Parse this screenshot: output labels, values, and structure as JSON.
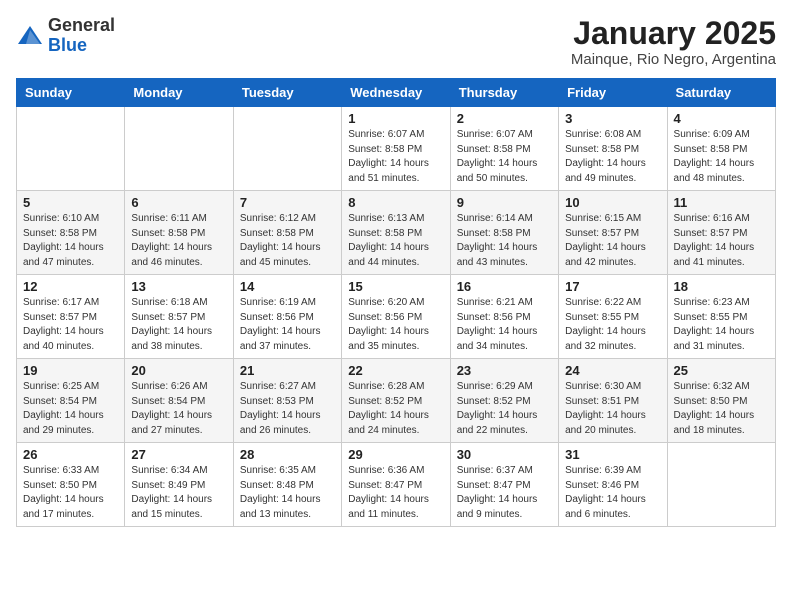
{
  "header": {
    "logo": {
      "general": "General",
      "blue": "Blue"
    },
    "title": "January 2025",
    "subtitle": "Mainque, Rio Negro, Argentina"
  },
  "weekdays": [
    "Sunday",
    "Monday",
    "Tuesday",
    "Wednesday",
    "Thursday",
    "Friday",
    "Saturday"
  ],
  "weeks": [
    [
      {
        "day": "",
        "sunrise": "",
        "sunset": "",
        "daylight": ""
      },
      {
        "day": "",
        "sunrise": "",
        "sunset": "",
        "daylight": ""
      },
      {
        "day": "",
        "sunrise": "",
        "sunset": "",
        "daylight": ""
      },
      {
        "day": "1",
        "sunrise": "Sunrise: 6:07 AM",
        "sunset": "Sunset: 8:58 PM",
        "daylight": "Daylight: 14 hours and 51 minutes."
      },
      {
        "day": "2",
        "sunrise": "Sunrise: 6:07 AM",
        "sunset": "Sunset: 8:58 PM",
        "daylight": "Daylight: 14 hours and 50 minutes."
      },
      {
        "day": "3",
        "sunrise": "Sunrise: 6:08 AM",
        "sunset": "Sunset: 8:58 PM",
        "daylight": "Daylight: 14 hours and 49 minutes."
      },
      {
        "day": "4",
        "sunrise": "Sunrise: 6:09 AM",
        "sunset": "Sunset: 8:58 PM",
        "daylight": "Daylight: 14 hours and 48 minutes."
      }
    ],
    [
      {
        "day": "5",
        "sunrise": "Sunrise: 6:10 AM",
        "sunset": "Sunset: 8:58 PM",
        "daylight": "Daylight: 14 hours and 47 minutes."
      },
      {
        "day": "6",
        "sunrise": "Sunrise: 6:11 AM",
        "sunset": "Sunset: 8:58 PM",
        "daylight": "Daylight: 14 hours and 46 minutes."
      },
      {
        "day": "7",
        "sunrise": "Sunrise: 6:12 AM",
        "sunset": "Sunset: 8:58 PM",
        "daylight": "Daylight: 14 hours and 45 minutes."
      },
      {
        "day": "8",
        "sunrise": "Sunrise: 6:13 AM",
        "sunset": "Sunset: 8:58 PM",
        "daylight": "Daylight: 14 hours and 44 minutes."
      },
      {
        "day": "9",
        "sunrise": "Sunrise: 6:14 AM",
        "sunset": "Sunset: 8:58 PM",
        "daylight": "Daylight: 14 hours and 43 minutes."
      },
      {
        "day": "10",
        "sunrise": "Sunrise: 6:15 AM",
        "sunset": "Sunset: 8:57 PM",
        "daylight": "Daylight: 14 hours and 42 minutes."
      },
      {
        "day": "11",
        "sunrise": "Sunrise: 6:16 AM",
        "sunset": "Sunset: 8:57 PM",
        "daylight": "Daylight: 14 hours and 41 minutes."
      }
    ],
    [
      {
        "day": "12",
        "sunrise": "Sunrise: 6:17 AM",
        "sunset": "Sunset: 8:57 PM",
        "daylight": "Daylight: 14 hours and 40 minutes."
      },
      {
        "day": "13",
        "sunrise": "Sunrise: 6:18 AM",
        "sunset": "Sunset: 8:57 PM",
        "daylight": "Daylight: 14 hours and 38 minutes."
      },
      {
        "day": "14",
        "sunrise": "Sunrise: 6:19 AM",
        "sunset": "Sunset: 8:56 PM",
        "daylight": "Daylight: 14 hours and 37 minutes."
      },
      {
        "day": "15",
        "sunrise": "Sunrise: 6:20 AM",
        "sunset": "Sunset: 8:56 PM",
        "daylight": "Daylight: 14 hours and 35 minutes."
      },
      {
        "day": "16",
        "sunrise": "Sunrise: 6:21 AM",
        "sunset": "Sunset: 8:56 PM",
        "daylight": "Daylight: 14 hours and 34 minutes."
      },
      {
        "day": "17",
        "sunrise": "Sunrise: 6:22 AM",
        "sunset": "Sunset: 8:55 PM",
        "daylight": "Daylight: 14 hours and 32 minutes."
      },
      {
        "day": "18",
        "sunrise": "Sunrise: 6:23 AM",
        "sunset": "Sunset: 8:55 PM",
        "daylight": "Daylight: 14 hours and 31 minutes."
      }
    ],
    [
      {
        "day": "19",
        "sunrise": "Sunrise: 6:25 AM",
        "sunset": "Sunset: 8:54 PM",
        "daylight": "Daylight: 14 hours and 29 minutes."
      },
      {
        "day": "20",
        "sunrise": "Sunrise: 6:26 AM",
        "sunset": "Sunset: 8:54 PM",
        "daylight": "Daylight: 14 hours and 27 minutes."
      },
      {
        "day": "21",
        "sunrise": "Sunrise: 6:27 AM",
        "sunset": "Sunset: 8:53 PM",
        "daylight": "Daylight: 14 hours and 26 minutes."
      },
      {
        "day": "22",
        "sunrise": "Sunrise: 6:28 AM",
        "sunset": "Sunset: 8:52 PM",
        "daylight": "Daylight: 14 hours and 24 minutes."
      },
      {
        "day": "23",
        "sunrise": "Sunrise: 6:29 AM",
        "sunset": "Sunset: 8:52 PM",
        "daylight": "Daylight: 14 hours and 22 minutes."
      },
      {
        "day": "24",
        "sunrise": "Sunrise: 6:30 AM",
        "sunset": "Sunset: 8:51 PM",
        "daylight": "Daylight: 14 hours and 20 minutes."
      },
      {
        "day": "25",
        "sunrise": "Sunrise: 6:32 AM",
        "sunset": "Sunset: 8:50 PM",
        "daylight": "Daylight: 14 hours and 18 minutes."
      }
    ],
    [
      {
        "day": "26",
        "sunrise": "Sunrise: 6:33 AM",
        "sunset": "Sunset: 8:50 PM",
        "daylight": "Daylight: 14 hours and 17 minutes."
      },
      {
        "day": "27",
        "sunrise": "Sunrise: 6:34 AM",
        "sunset": "Sunset: 8:49 PM",
        "daylight": "Daylight: 14 hours and 15 minutes."
      },
      {
        "day": "28",
        "sunrise": "Sunrise: 6:35 AM",
        "sunset": "Sunset: 8:48 PM",
        "daylight": "Daylight: 14 hours and 13 minutes."
      },
      {
        "day": "29",
        "sunrise": "Sunrise: 6:36 AM",
        "sunset": "Sunset: 8:47 PM",
        "daylight": "Daylight: 14 hours and 11 minutes."
      },
      {
        "day": "30",
        "sunrise": "Sunrise: 6:37 AM",
        "sunset": "Sunset: 8:47 PM",
        "daylight": "Daylight: 14 hours and 9 minutes."
      },
      {
        "day": "31",
        "sunrise": "Sunrise: 6:39 AM",
        "sunset": "Sunset: 8:46 PM",
        "daylight": "Daylight: 14 hours and 6 minutes."
      },
      {
        "day": "",
        "sunrise": "",
        "sunset": "",
        "daylight": ""
      }
    ]
  ]
}
